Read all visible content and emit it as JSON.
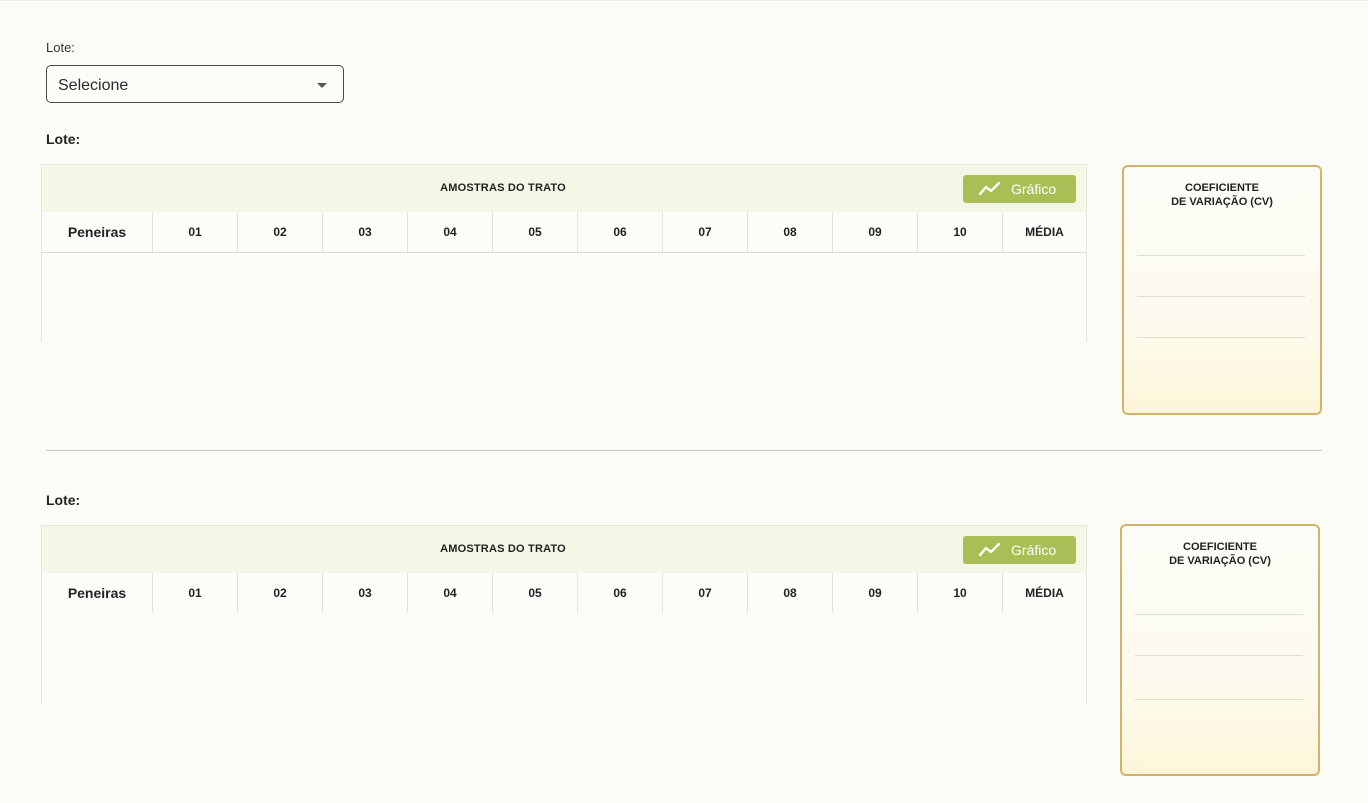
{
  "lote_select": {
    "label": "Lote:",
    "selected": "Selecione"
  },
  "sections": [
    {
      "lote_label": "Lote:",
      "table_title": "AMOSTRAS DO TRATO",
      "chart_button": "Gráfico",
      "columns": [
        "Peneiras",
        "01",
        "02",
        "03",
        "04",
        "05",
        "06",
        "07",
        "08",
        "09",
        "10",
        "MÉDIA"
      ],
      "cv_title_line1": "COEFICIENTE",
      "cv_title_line2": "DE VARIAÇÃO (CV)"
    },
    {
      "lote_label": "Lote:",
      "table_title": "AMOSTRAS DO TRATO",
      "chart_button": "Gráfico",
      "columns": [
        "Peneiras",
        "01",
        "02",
        "03",
        "04",
        "05",
        "06",
        "07",
        "08",
        "09",
        "10",
        "MÉDIA"
      ],
      "cv_title_line1": "COEFICIENTE",
      "cv_title_line2": "DE VARIAÇÃO (CV)"
    }
  ],
  "colors": {
    "accent_green": "#a8bf55",
    "cv_border": "#d3b36a",
    "table_header_bg": "#f4f6e6"
  }
}
